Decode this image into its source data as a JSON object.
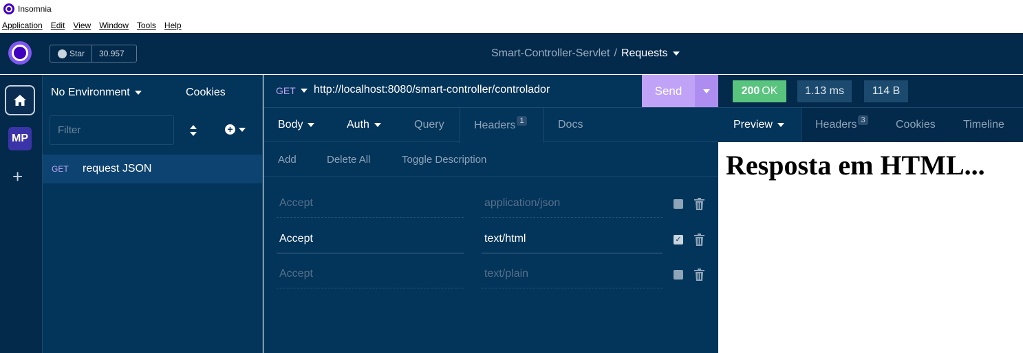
{
  "window": {
    "title": "Insomnia"
  },
  "menu": [
    "Application",
    "Edit",
    "View",
    "Window",
    "Tools",
    "Help"
  ],
  "header": {
    "star_label": "Star",
    "star_count": "30.957",
    "project": "Smart-Controller-Servlet",
    "separator": "/",
    "collection": "Requests"
  },
  "rail": {
    "workspace_badge": "MP",
    "add_label": "+"
  },
  "sidebar": {
    "environment": "No Environment",
    "cookies": "Cookies",
    "filter_placeholder": "Filter",
    "requests": [
      {
        "method": "GET",
        "name": "request JSON"
      }
    ]
  },
  "request": {
    "method": "GET",
    "url": "http://localhost:8080/smart-controller/controlador",
    "send_label": "Send",
    "tabs": {
      "body": "Body",
      "auth": "Auth",
      "query": "Query",
      "headers": "Headers",
      "headers_count": "1",
      "docs": "Docs"
    },
    "actions": {
      "add": "Add",
      "delete_all": "Delete All",
      "toggle_description": "Toggle Description"
    },
    "headers": [
      {
        "name": "Accept",
        "value": "application/json",
        "enabled": false
      },
      {
        "name": "Accept",
        "value": "text/html",
        "enabled": true
      },
      {
        "name": "Accept",
        "value": "text/plain",
        "enabled": false
      }
    ]
  },
  "response": {
    "status_code": "200",
    "status_text": "OK",
    "time": "1.13 ms",
    "size": "114 B",
    "tabs": {
      "preview": "Preview",
      "headers": "Headers",
      "headers_count": "3",
      "cookies": "Cookies",
      "timeline": "Timeline"
    },
    "body_heading": "Resposta em HTML..."
  },
  "colors": {
    "app_bg": "#03294b",
    "panel_bg": "#03345a",
    "send": "#c0a2f7",
    "status_ok": "#58c47d",
    "method_get": "#b9a6f2"
  },
  "icons": [
    "insomnia-logo-icon",
    "github-icon",
    "home-icon",
    "plus-icon",
    "sort-icon",
    "add-circle-icon",
    "caret-down-icon",
    "checkbox-icon",
    "trash-icon"
  ]
}
